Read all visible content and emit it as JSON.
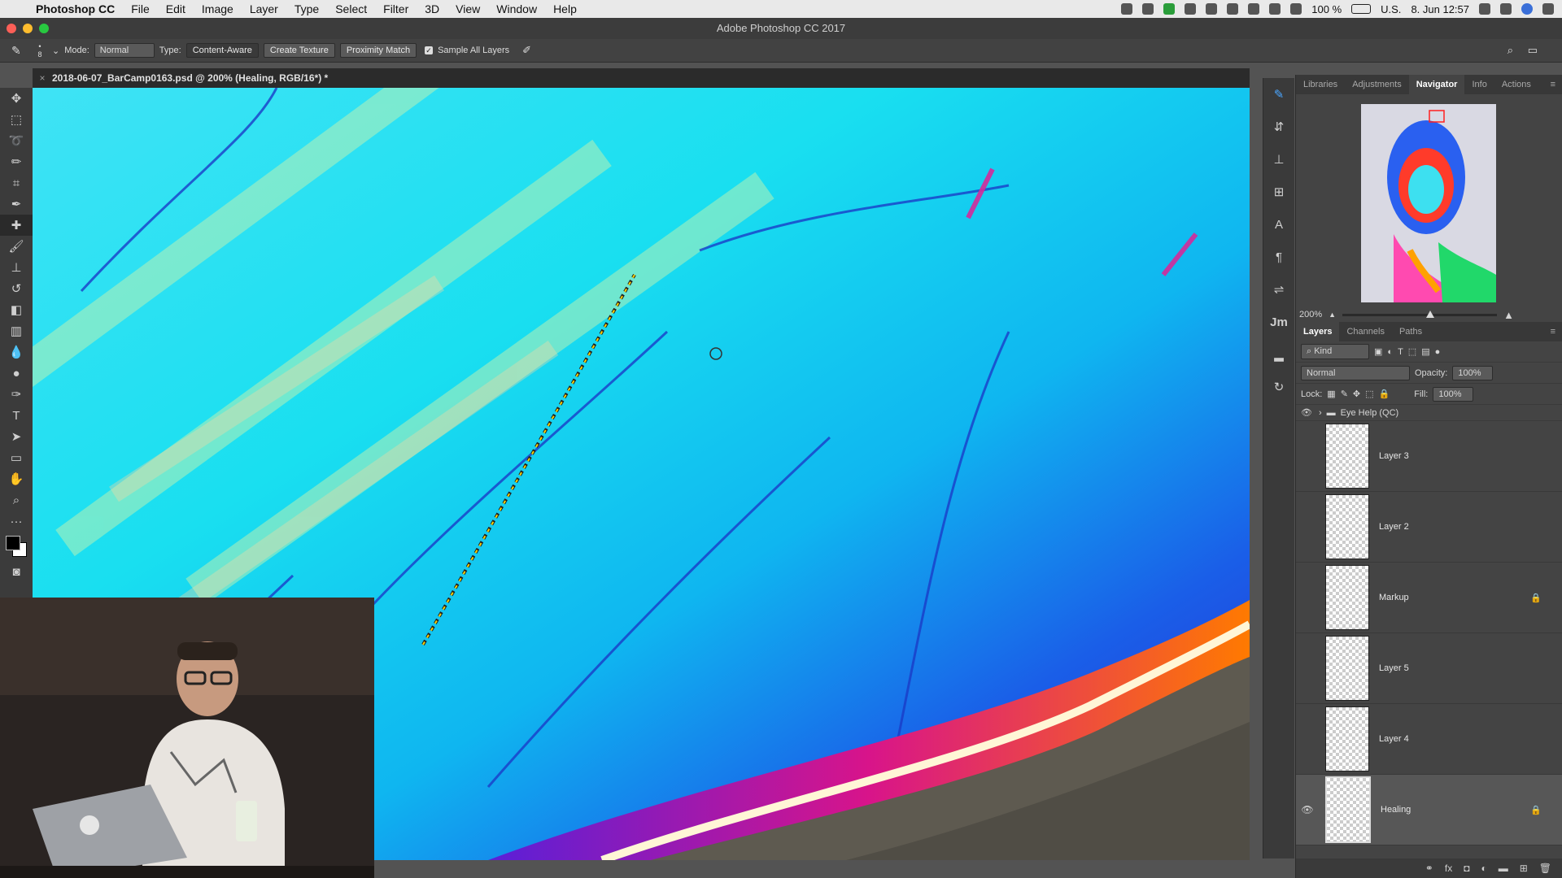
{
  "menubar": {
    "app_name": "Photoshop CC",
    "items": [
      "File",
      "Edit",
      "Image",
      "Layer",
      "Type",
      "Select",
      "Filter",
      "3D",
      "View",
      "Window",
      "Help"
    ],
    "battery": "100 %",
    "input_source": "U.S.",
    "datetime": "8. Jun  12:57"
  },
  "window": {
    "title": "Adobe Photoshop CC 2017"
  },
  "options": {
    "brush_size": "8",
    "mode_label": "Mode:",
    "mode_value": "Normal",
    "type_label": "Type:",
    "type_buttons": [
      "Content-Aware",
      "Create Texture",
      "Proximity Match"
    ],
    "sample_all_layers": "Sample All Layers"
  },
  "document": {
    "tab_title": "2018-06-07_BarCamp0163.psd @ 200% (Healing, RGB/16*) *"
  },
  "panels": {
    "top_tabs": [
      "Libraries",
      "Adjustments",
      "Navigator",
      "Info",
      "Actions"
    ],
    "active_top_tab": "Navigator",
    "navigator_zoom": "200%",
    "navigator_zoom_fraction": 0.57,
    "layer_tabs": [
      "Layers",
      "Channels",
      "Paths"
    ],
    "kind_filter": "Kind",
    "blend_mode": "Normal",
    "opacity_label": "Opacity:",
    "opacity_value": "100%",
    "lock_label": "Lock:",
    "fill_label": "Fill:",
    "fill_value": "100%",
    "group_name": "Eye Help (QC)",
    "layers": [
      {
        "name": "Layer 3",
        "visible": false,
        "locked": false
      },
      {
        "name": "Layer 2",
        "visible": false,
        "locked": false
      },
      {
        "name": "Markup",
        "visible": false,
        "locked": true
      },
      {
        "name": "Layer 5",
        "visible": false,
        "locked": false
      },
      {
        "name": "Layer 4",
        "visible": false,
        "locked": false
      },
      {
        "name": "Healing",
        "visible": true,
        "locked": true
      }
    ]
  },
  "colors": {
    "canvas_cyan": "#22e6f0",
    "canvas_blue": "#1565e8",
    "accent_orange": "#ff6a00"
  }
}
